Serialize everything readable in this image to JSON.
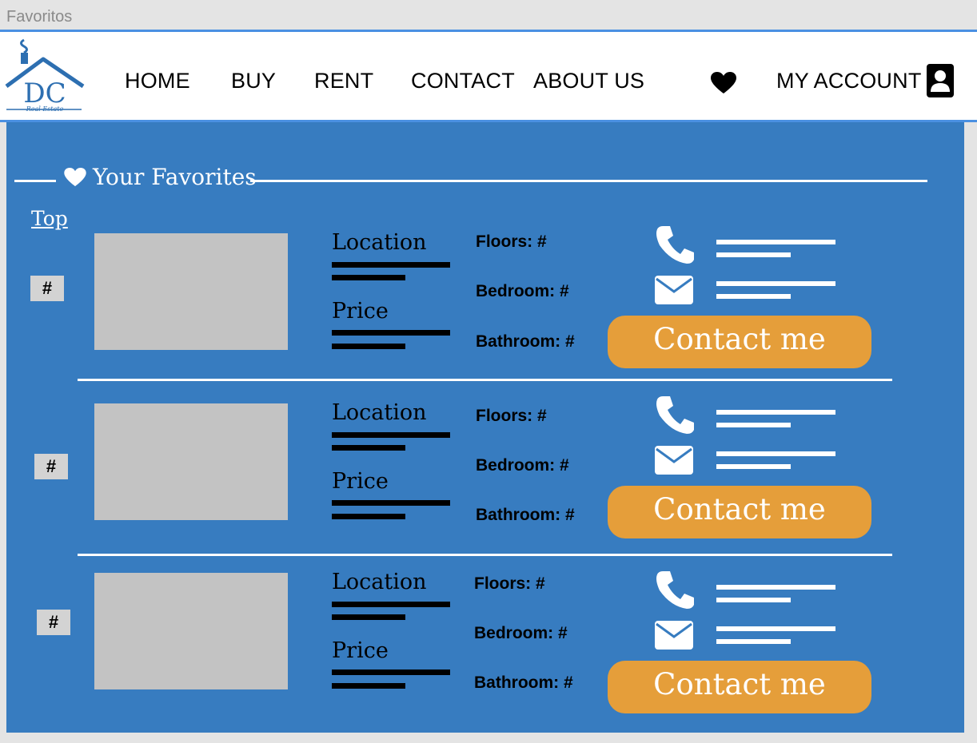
{
  "frame": {
    "label": "Favoritos"
  },
  "header": {
    "nav": [
      "HOME",
      "BUY",
      "RENT",
      "CONTACT",
      "ABOUT US"
    ],
    "account_label": "MY ACCOUNT",
    "icons": {
      "favorites": "heart-icon",
      "account": "user-profile-icon"
    },
    "logo": {
      "letters": "DC",
      "tagline": "Real Estate"
    }
  },
  "main": {
    "title": "Your Favorites",
    "top_link": "Top",
    "colors": {
      "background": "#377cc0",
      "button": "#e59e3a",
      "thumb": "#c3c3c3"
    },
    "listings": [
      {
        "number": "#",
        "location_label": "Location",
        "price_label": "Price",
        "floors": "Floors: #",
        "bedroom": "Bedroom: #",
        "bathroom": "Bathroom: #",
        "button": "Contact me"
      },
      {
        "number": "#",
        "location_label": "Location",
        "price_label": "Price",
        "floors": "Floors: #",
        "bedroom": "Bedroom: #",
        "bathroom": "Bathroom: #",
        "button": "Contact me"
      },
      {
        "number": "#",
        "location_label": "Location",
        "price_label": "Price",
        "floors": "Floors: #",
        "bedroom": "Bedroom: #",
        "bathroom": "Bathroom: #",
        "button": "Contact me"
      }
    ]
  }
}
